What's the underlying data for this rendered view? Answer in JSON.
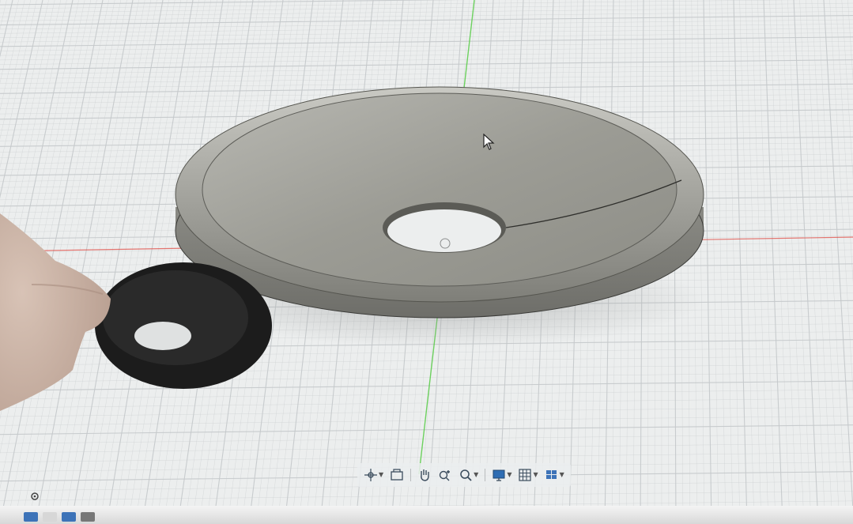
{
  "app": {
    "name": "3D CAD viewport"
  },
  "colors": {
    "grid_background": "#eceeee",
    "grid_line": "#c4c8ca",
    "axis_x": "#e0433b",
    "axis_y": "#4ecb3c",
    "model_surface": "#a3a39c",
    "physical_part": "#1a1a1a"
  },
  "model": {
    "name": "speaker-surround-disc",
    "visible_label": ""
  },
  "navigation_toolbar": {
    "tools": [
      {
        "icon": "orbit-icon",
        "has_dropdown": true
      },
      {
        "icon": "look-at-icon",
        "has_dropdown": false
      },
      {
        "icon": "pan-hand-icon",
        "has_dropdown": false
      },
      {
        "icon": "zoom-icon",
        "has_dropdown": false
      },
      {
        "icon": "zoom-window-icon",
        "has_dropdown": true
      },
      {
        "icon": "display-settings-icon",
        "has_dropdown": true
      },
      {
        "icon": "grid-settings-icon",
        "has_dropdown": true
      },
      {
        "icon": "viewports-icon",
        "has_dropdown": true
      }
    ]
  },
  "corner_control": {
    "icon": "zoom-dot-icon"
  }
}
